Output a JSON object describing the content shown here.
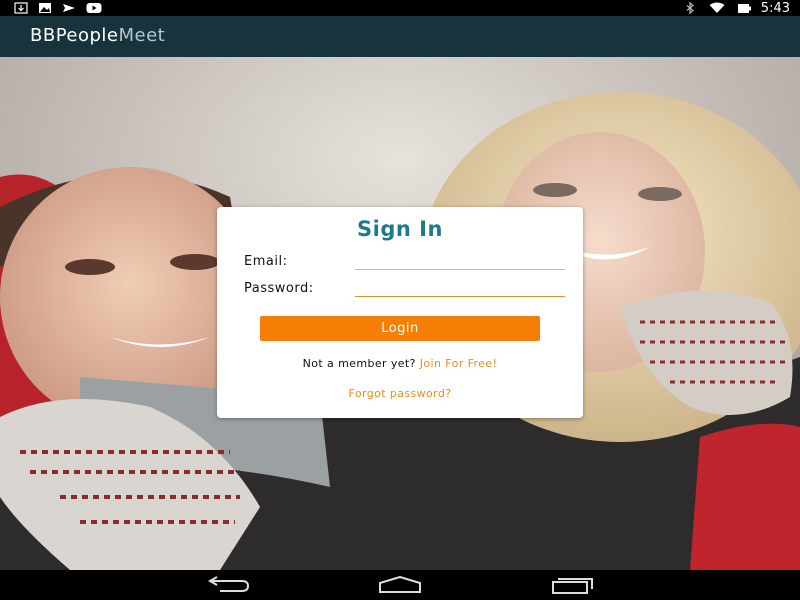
{
  "status_bar": {
    "time": "5:43",
    "left_icons": [
      "download-icon",
      "image-icon",
      "send-icon",
      "youtube-icon"
    ],
    "right_icons": [
      "bluetooth-icon",
      "wifi-icon",
      "battery-icon"
    ]
  },
  "app_bar": {
    "title_part1": "BBPeople",
    "title_part2": "Meet"
  },
  "login_card": {
    "title": "Sign In",
    "email_label": "Email:",
    "email_value": "",
    "password_label": "Password:",
    "password_value": "",
    "login_label": "Login",
    "member_prompt": "Not a member yet?",
    "join_label": "Join For Free!",
    "forgot_label": "Forgot password?"
  },
  "colors": {
    "app_bar": "#17343d",
    "accent": "#f57f06",
    "title": "#1d7a8c"
  },
  "nav_bar": {
    "buttons": [
      "back-icon",
      "home-icon",
      "recents-icon"
    ]
  }
}
